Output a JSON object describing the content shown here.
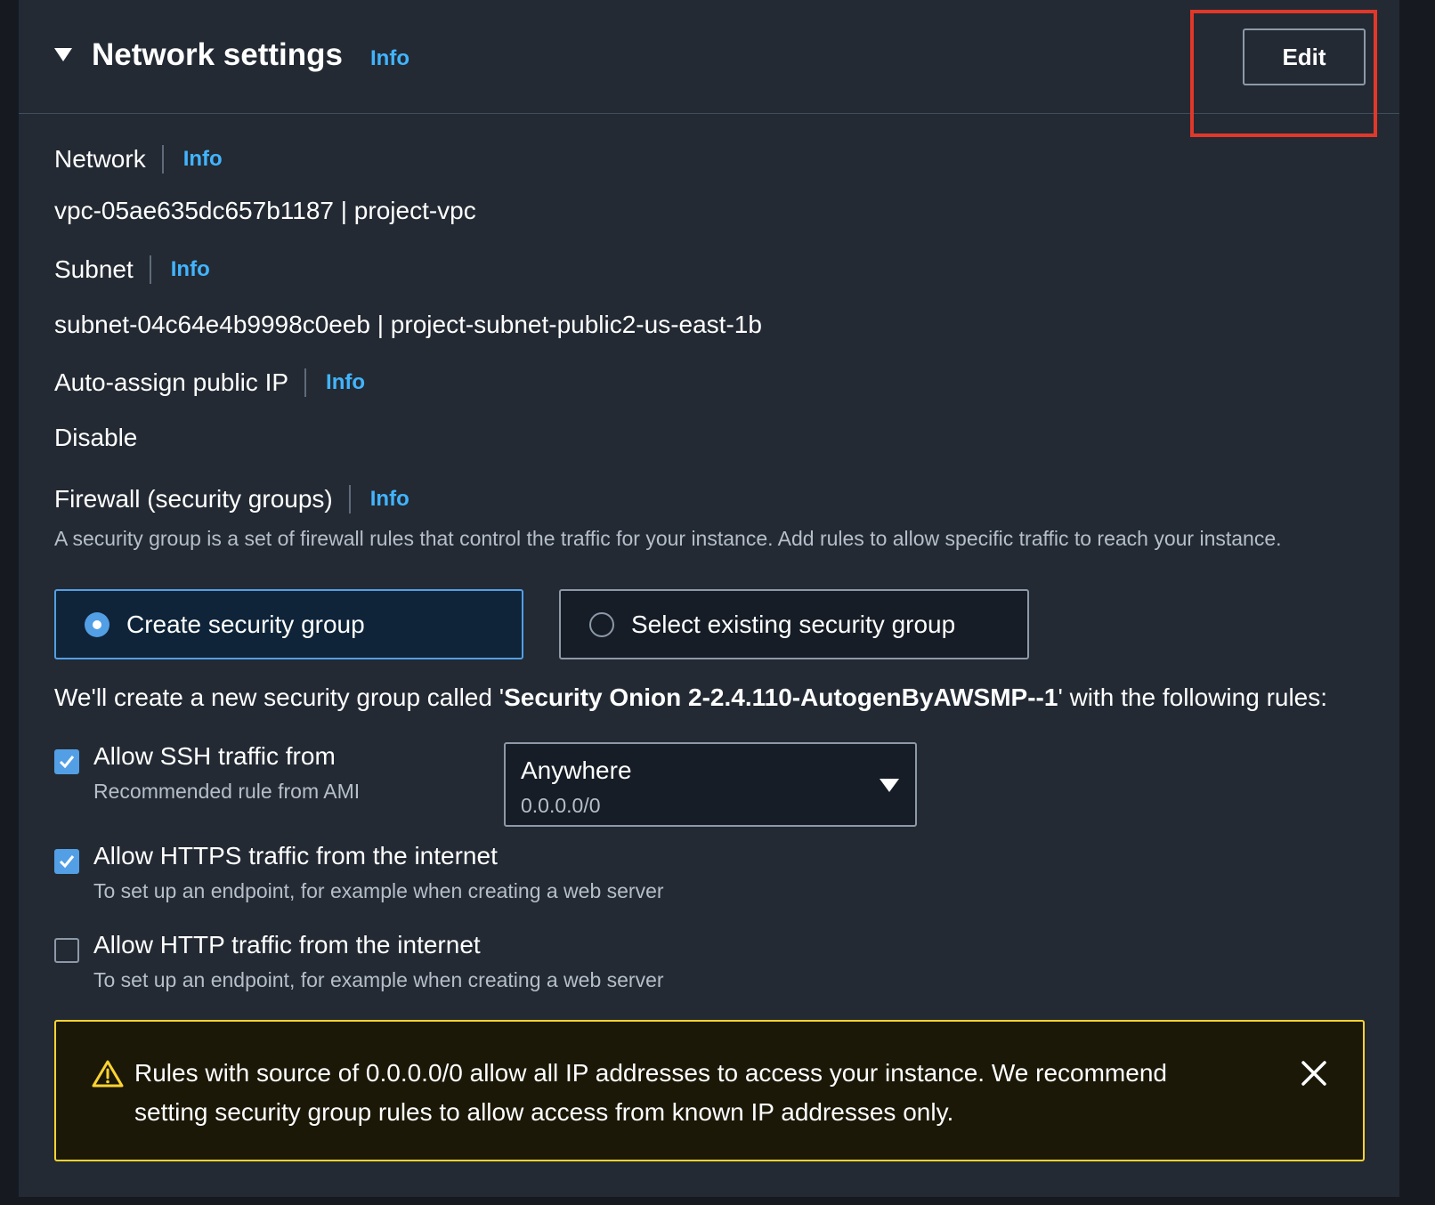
{
  "header": {
    "title": "Network settings",
    "info": "Info",
    "edit_label": "Edit"
  },
  "network": {
    "label": "Network",
    "info": "Info",
    "value": "vpc-05ae635dc657b1187 | project-vpc"
  },
  "subnet": {
    "label": "Subnet",
    "info": "Info",
    "value": "subnet-04c64e4b9998c0eeb | project-subnet-public2-us-east-1b"
  },
  "auto_ip": {
    "label": "Auto-assign public IP",
    "info": "Info",
    "value": "Disable"
  },
  "firewall": {
    "label": "Firewall (security groups)",
    "info": "Info",
    "description": "A security group is a set of firewall rules that control the traffic for your instance. Add rules to allow specific traffic to reach your instance.",
    "options": [
      {
        "label": "Create security group",
        "selected": true
      },
      {
        "label": "Select existing security group",
        "selected": false
      }
    ],
    "create_prefix": "We'll create a new security group called '",
    "group_name": "Security Onion 2-2.4.110-AutogenByAWSMP--1",
    "create_suffix": "' with the following rules:"
  },
  "rules": [
    {
      "label": "Allow SSH traffic from",
      "sub": "Recommended rule from AMI",
      "checked": true
    },
    {
      "label": "Allow HTTPS traffic from the internet",
      "sub": "To set up an endpoint, for example when creating a web server",
      "checked": true
    },
    {
      "label": "Allow HTTP traffic from the internet",
      "sub": "To set up an endpoint, for example when creating a web server",
      "checked": false
    }
  ],
  "ssh_source": {
    "value": "Anywhere",
    "sub": "0.0.0.0/0"
  },
  "warning": {
    "text": "Rules with source of 0.0.0.0/0 allow all IP addresses to access your instance. We recommend setting security group rules to allow access from known IP addresses only.",
    "icon": "warning-triangle-icon",
    "close_icon": "close-icon"
  },
  "colors": {
    "panel_bg": "#232a33",
    "accent": "#539fe5",
    "link": "#42b4ff",
    "warning_border": "#fbd332",
    "highlight": "#e0382b"
  }
}
